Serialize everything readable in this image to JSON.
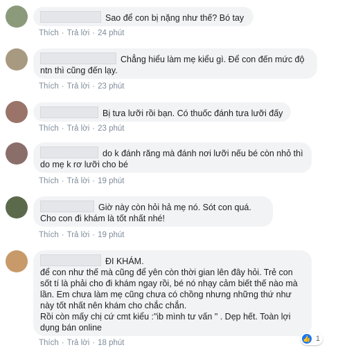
{
  "actions": {
    "like": "Thích",
    "reply": "Trả lời",
    "sep": "·"
  },
  "comments": [
    {
      "text": "Sao để con bị nặng như thế? Bó tay",
      "time": "24 phút",
      "avatar_color": "#8a9a7a"
    },
    {
      "text": "Chẳng hiểu làm mẹ kiểu gì. Để con đến mức độ ntn thì cũng đến lạy.",
      "time": "23 phút",
      "avatar_color": "#a89a80"
    },
    {
      "text": "Bị tưa lưỡi rồi bạn. Có thuốc đánh tưa lưỡi đấy",
      "time": "23 phút",
      "avatar_color": "#9a7468"
    },
    {
      "text": "do k đánh răng mà đánh nơi lưỡi nếu bé còn nhỏ thì do mẹ k rơ lưỡi cho bé",
      "time": "19 phút",
      "avatar_color": "#8a6e6a"
    },
    {
      "text": "Giờ này còn hỏi hả mẹ nó. Sót con quá. Cho con đi khám là tốt nhất nhé!",
      "time": "19 phút",
      "avatar_color": "#5c6a4c"
    },
    {
      "text_head": "ĐI KHÁM.",
      "text_body": "để con như thế mà cũng để yên còn thời gian lên đây hỏi. Trẻ con sốt tí là phải cho đi khám ngay rồi, bé nó nhạy cảm biết thế nào mà lần. Em chưa làm mẹ cũng chưa có chồng nhưng những thứ như này tốt nhất nên khám cho chắc chắn.",
      "text_tail": "Rồi còn mấy chị cứ cmt kiểu :\"ib mình tư vấn \" . Dẹp hết. Toàn lợi dụng bán online",
      "time": "18 phút",
      "avatar_color": "#c89a6a",
      "reaction_count": "1"
    }
  ]
}
